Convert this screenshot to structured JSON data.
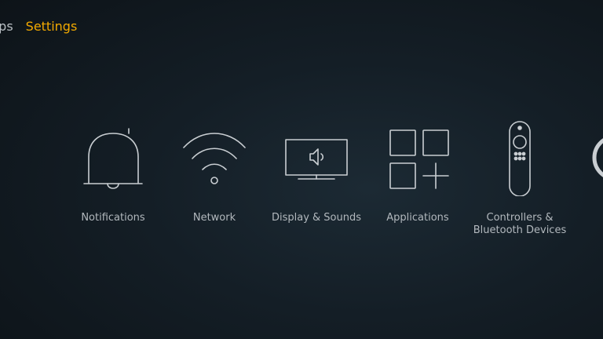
{
  "nav": {
    "items": [
      {
        "label": "pps",
        "active": false
      },
      {
        "label": "Settings",
        "active": true
      }
    ]
  },
  "tiles": [
    {
      "label": "Notifications",
      "icon": "bell-icon"
    },
    {
      "label": "Network",
      "icon": "wifi-icon"
    },
    {
      "label": "Display & Sounds",
      "icon": "display-sound-icon"
    },
    {
      "label": "Applications",
      "icon": "applications-icon"
    },
    {
      "label": "Controllers &\nBluetooth Devices",
      "icon": "remote-controller-icon"
    }
  ],
  "colors": {
    "accent": "#f2a900",
    "text": "#b2b8bd",
    "icon_stroke": "#c9ced2",
    "background": "#141e26"
  }
}
